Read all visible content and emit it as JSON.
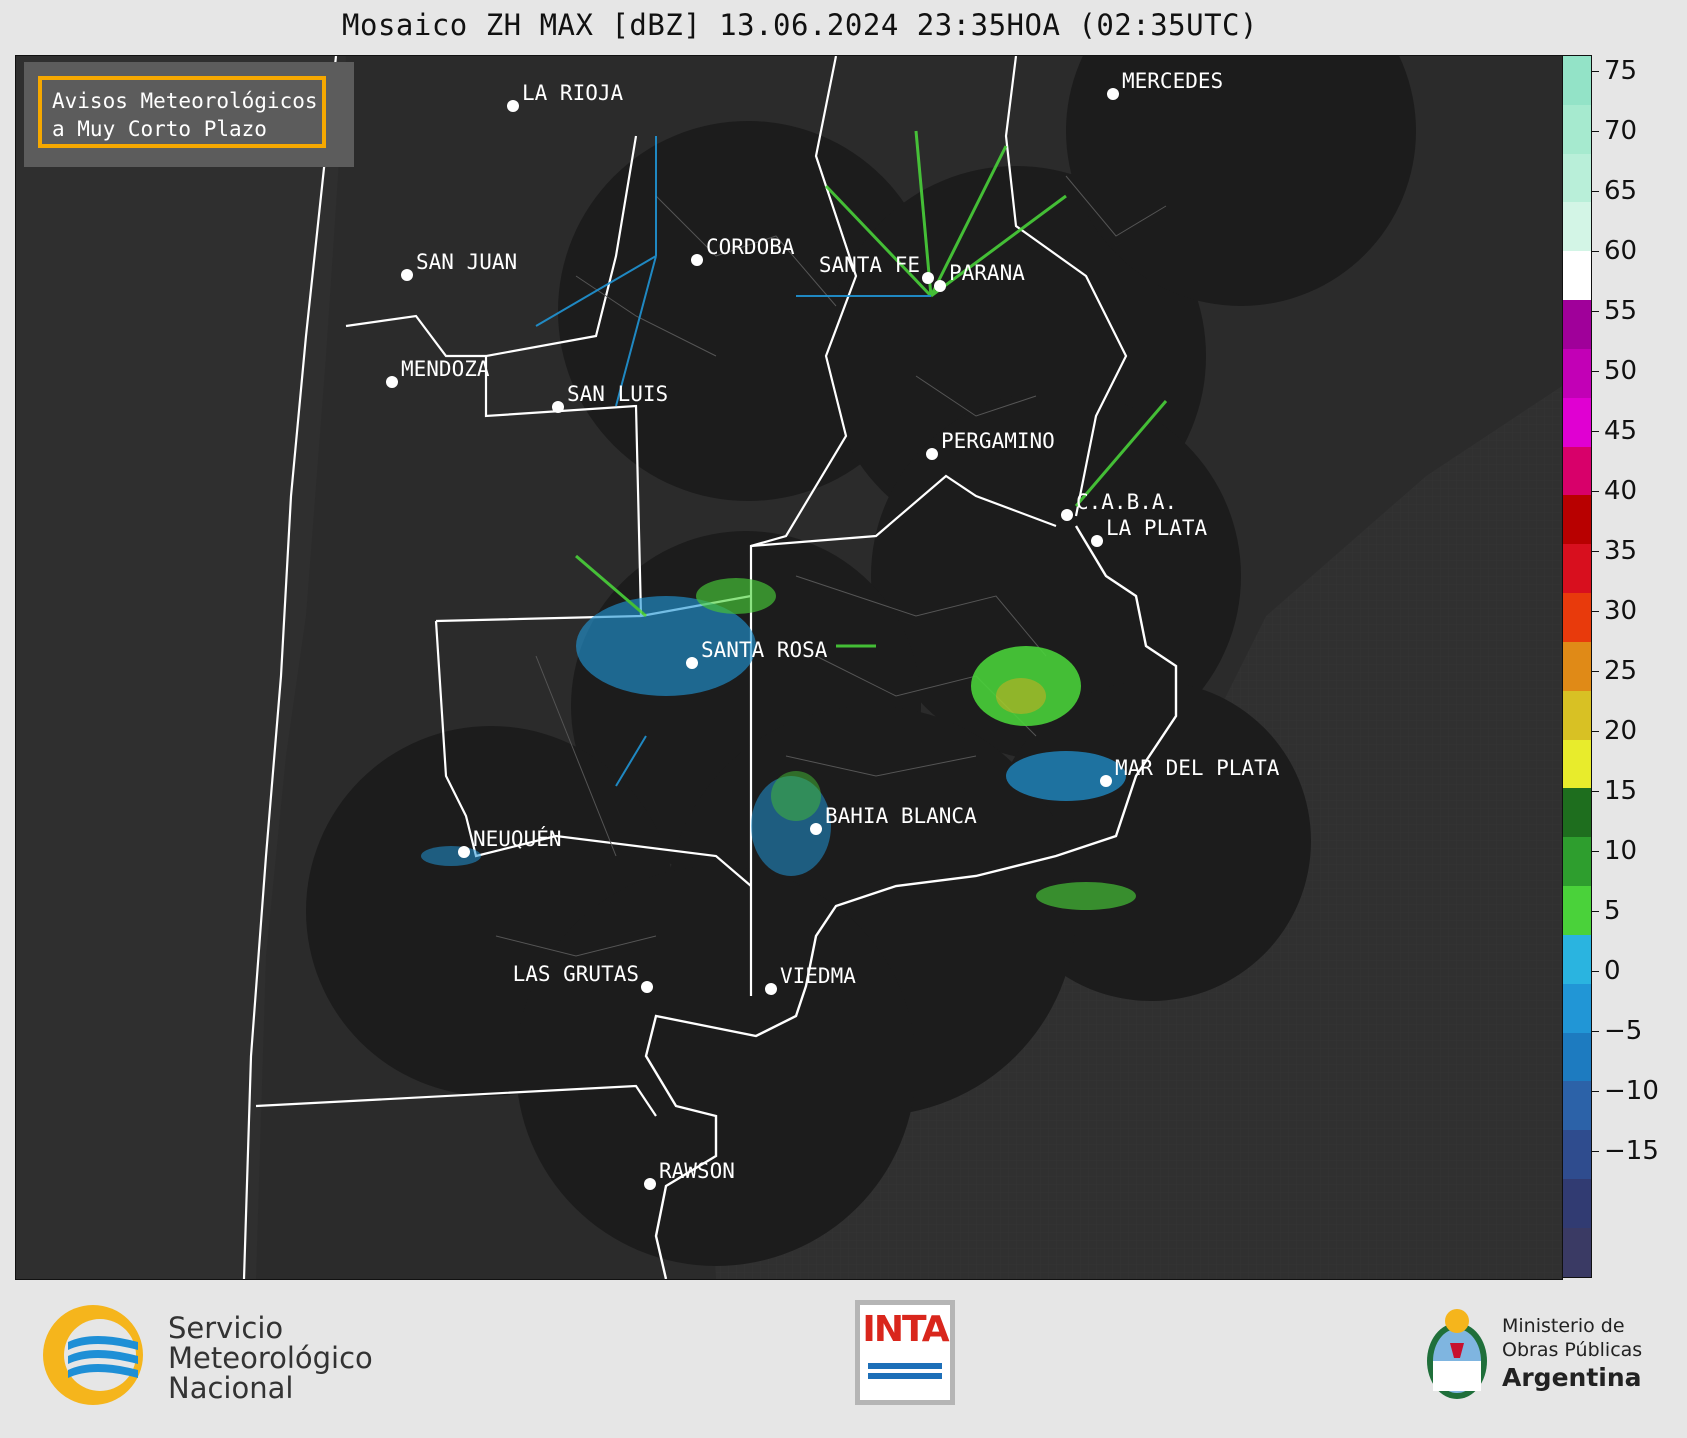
{
  "title": "Mosaico ZH MAX [dBZ] 13.06.2024 23:35HOA (02:35UTC)",
  "alert_box": {
    "line1": "Avisos Meteorológicos",
    "line2": "a Muy Corto Plazo"
  },
  "cities": [
    {
      "name": "LA RIOJA"
    },
    {
      "name": "MERCEDES"
    },
    {
      "name": "CORDOBA"
    },
    {
      "name": "SAN JUAN"
    },
    {
      "name": "SANTA FE"
    },
    {
      "name": "PARANA"
    },
    {
      "name": "MENDOZA"
    },
    {
      "name": "SAN LUIS"
    },
    {
      "name": "PERGAMINO"
    },
    {
      "name": "C.A.B.A."
    },
    {
      "name": "LA PLATA"
    },
    {
      "name": "SANTA ROSA"
    },
    {
      "name": "MAR DEL PLATA"
    },
    {
      "name": "BAHIA BLANCA"
    },
    {
      "name": "NEUQUÉN"
    },
    {
      "name": "LAS GRUTAS"
    },
    {
      "name": "VIEDMA"
    },
    {
      "name": "RAWSON"
    }
  ],
  "colorbar": {
    "ticks": [
      "75",
      "70",
      "65",
      "60",
      "55",
      "50",
      "45",
      "40",
      "35",
      "30",
      "25",
      "20",
      "15",
      "10",
      "5",
      "0",
      "−5",
      "−10",
      "−15"
    ],
    "colors": [
      "#93e3c7",
      "#a6eacf",
      "#b9efd9",
      "#d3f5e6",
      "#ffffff",
      "#a0009a",
      "#c200b6",
      "#e000d2",
      "#d8006a",
      "#b80000",
      "#d80f1e",
      "#e83a0c",
      "#e08a17",
      "#d8c124",
      "#e8ec2c",
      "#1e6e1e",
      "#2e9e2e",
      "#4ad23a",
      "#2ab4e0",
      "#2196d6",
      "#1d7bc0",
      "#2c62a8",
      "#2f4c8e",
      "#313b72",
      "#3a3a64"
    ]
  },
  "footer": {
    "smn": {
      "line1": "Servicio",
      "line2": "Meteorológico",
      "line3": "Nacional"
    },
    "inta": "INTA",
    "ministerio": {
      "line1": "Ministerio de",
      "line2": "Obras Públicas",
      "line3": "Argentina"
    }
  }
}
